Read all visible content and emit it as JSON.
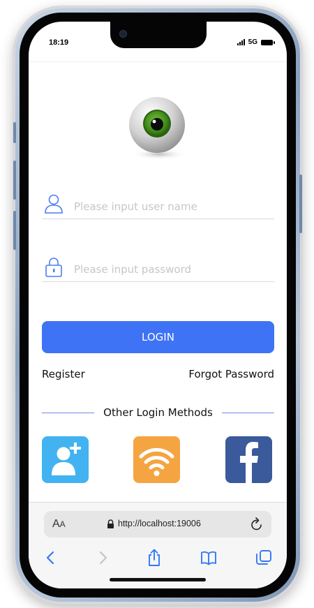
{
  "status_bar": {
    "time": "18:19",
    "network": "5G"
  },
  "login_form": {
    "username_placeholder": "Please input user name",
    "password_placeholder": "Please input password",
    "login_label": "LOGIN",
    "register_label": "Register",
    "forgot_label": "Forgot Password"
  },
  "other_methods": {
    "title": "Other Login Methods",
    "items": [
      {
        "icon": "add-contact-icon",
        "color": "#42b3f0"
      },
      {
        "icon": "wifi-icon",
        "color": "#f4a541"
      },
      {
        "icon": "facebook-icon",
        "color": "#3b5a9b"
      }
    ]
  },
  "browser": {
    "aa_big": "A",
    "aa_small": "A",
    "url": "http://localhost:19006"
  },
  "colors": {
    "accent": "#3f73f5",
    "divider": "#7d87dd",
    "icon_blue": "#4a7cf3"
  }
}
